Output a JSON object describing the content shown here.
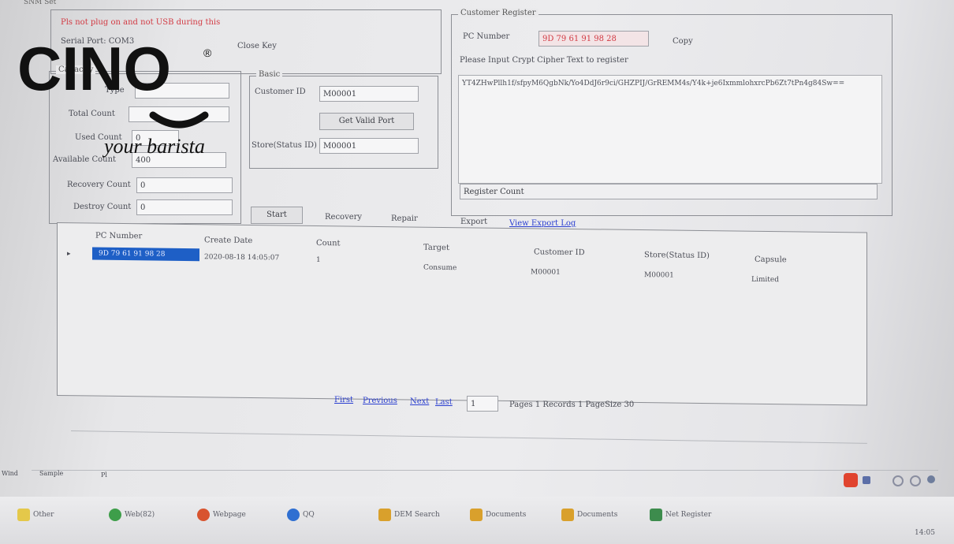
{
  "top_group": {
    "title": "SNM Set",
    "warning": "Pls not plug on and not USB during this",
    "serial_port_label": "Serial Port: COM3",
    "close_label": "Close Key"
  },
  "capacity": {
    "title": "Capacity",
    "type_label": "Type",
    "type_value": "",
    "total_count_label": "Total Count",
    "total_count_value": "",
    "used_count_label": "Used Count",
    "used_count_value": "0",
    "available_count_label": "Available Count",
    "available_count_value": "400",
    "recovery_count_label": "Recovery Count",
    "recovery_count_value": "0",
    "destroy_count_label": "Destroy Count",
    "destroy_count_value": "0"
  },
  "basic": {
    "title": "Basic",
    "customer_id_label": "Customer ID",
    "customer_id_value": "M00001",
    "get_valid_port_label": "Get Valid Port",
    "store_status_label": "Store(Status ID)",
    "store_status_value": "M00001"
  },
  "actions": {
    "start": "Start",
    "recovery": "Recovery",
    "repair": "Repair"
  },
  "customer_register": {
    "title": "Customer Register",
    "pc_number_label": "PC Number",
    "pc_number_value": "9D 79 61 91 98 28",
    "copy_label": "Copy",
    "please_input": "Please Input  Crypt Cipher Text to register",
    "cipher_text": "YT4ZHwPllh1f/sfpyM6QgbNk/Yo4DdJ6r9ci/GHZPIJ/GrREMM4s/Y4k+je6IxmmlohxrcPb6Zt7tPn4g84Sw==",
    "register_count_label": "Register Count",
    "export_label": "Export",
    "view_export_log": "View Export Log"
  },
  "grid": {
    "columns": [
      "PC Number",
      "Create Date",
      "Count",
      "Target",
      "Customer ID",
      "Store(Status ID)",
      "Capsule"
    ],
    "rows": [
      [
        "9D 79 61 91 98 28",
        "2020-08-18 14:05:07",
        "1",
        "Consume",
        "M00001",
        "M00001",
        "Limited"
      ]
    ]
  },
  "pager": {
    "first": "First",
    "previous": "Previous",
    "next": "Next",
    "last": "Last",
    "page_value": "1",
    "info": "Pages  1 Records  1 PageSize  30"
  },
  "status_strip": {
    "left1": "Wind",
    "left2": "Sample",
    "left3": "Pl"
  },
  "taskbar": {
    "items": [
      {
        "label": "Other",
        "color": "#e4c84a"
      },
      {
        "label": "Web(82)",
        "color": "#3e9e4a"
      },
      {
        "label": "Webpage",
        "color": "#d8542f"
      },
      {
        "label": "QQ",
        "color": "#2f6fd1"
      },
      {
        "label": "DEM Search",
        "color": "#d9a02c"
      },
      {
        "label": "Documents",
        "color": "#d9a02c"
      },
      {
        "label": "Documents",
        "color": "#d9a02c"
      },
      {
        "label": "Net Register",
        "color": "#3d8c4d"
      }
    ],
    "time": "14:05"
  },
  "logo": {
    "brand": "CINO",
    "tagline": "your barista",
    "registered": "®"
  },
  "colors": {
    "selection": "#1e5fc6",
    "link": "#2b3fd0",
    "warning": "#d23a43"
  }
}
